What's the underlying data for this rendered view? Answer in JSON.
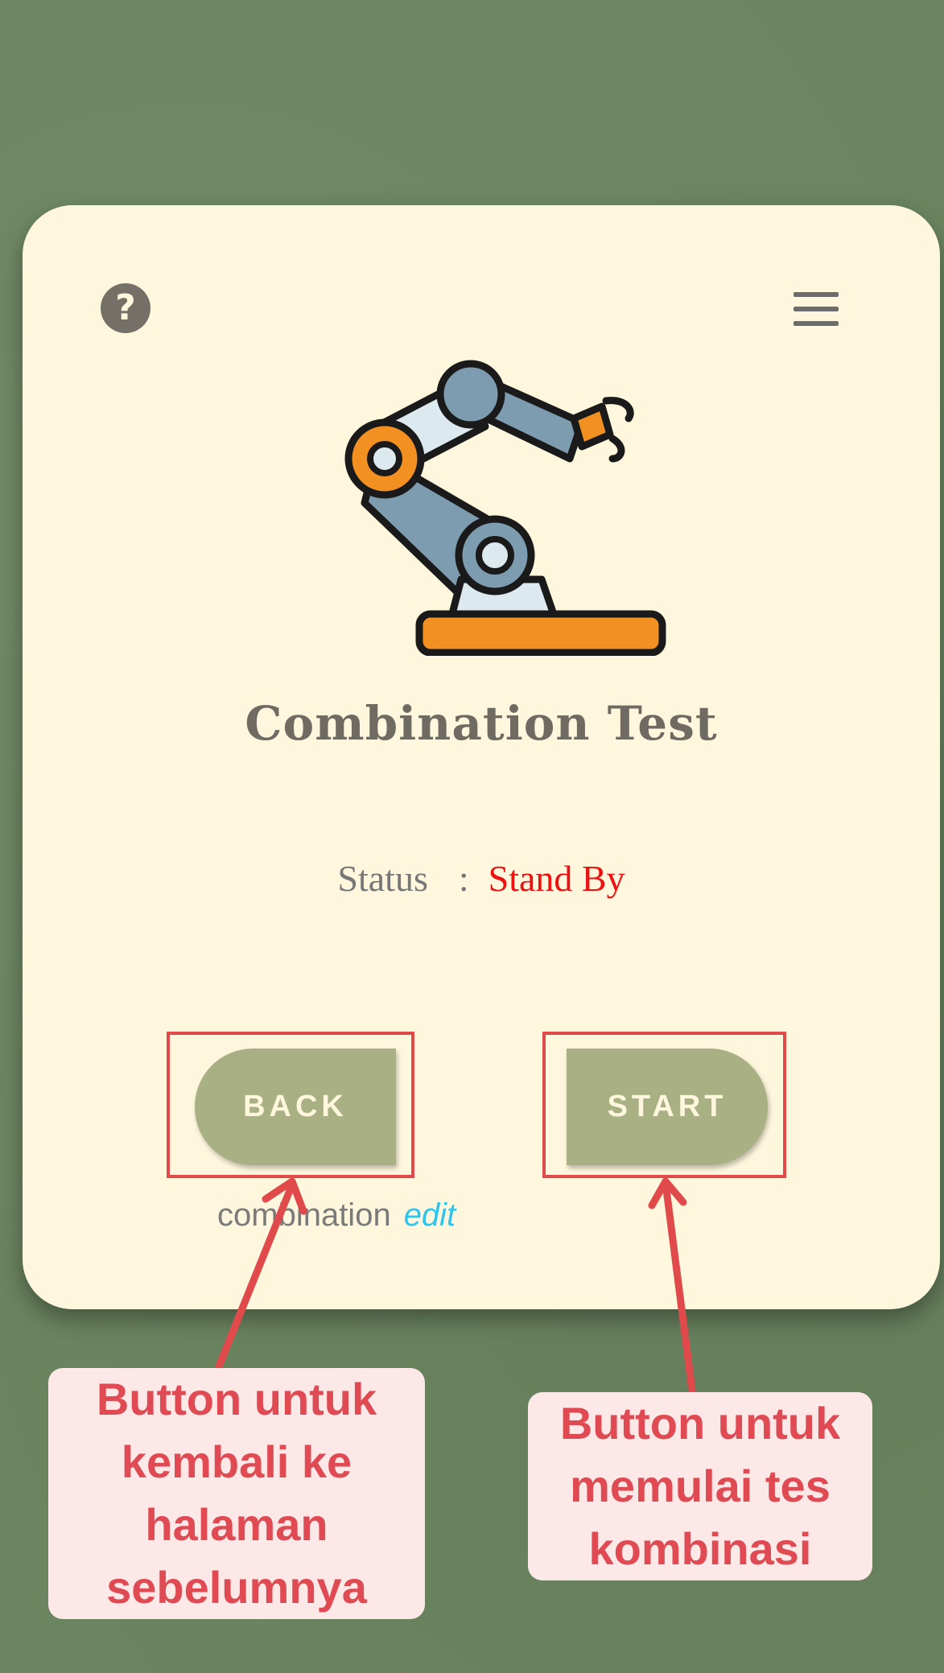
{
  "screen": {
    "title": "Combination Test",
    "status_label": "Status",
    "status_colon": ":",
    "status_value": "Stand By",
    "back_label": "BACK",
    "start_label": "START",
    "caption_text": "combination",
    "caption_link": "edit",
    "icons": {
      "help": "question-mark-circle-icon",
      "menu": "hamburger-menu-icon",
      "hero": "robotic-arm-icon"
    }
  },
  "annotations": {
    "back_note": "Button untuk kembali ke halaman sebelumnya",
    "start_note": "Button untuk memulai tes kombinasi"
  },
  "colors": {
    "background": "#6b8560",
    "card": "#fef7dd",
    "button": "#a9b084",
    "status_value": "#ee1111",
    "link": "#2ec4ee",
    "annotation": "#e04a4a",
    "annotation_bg": "#fde8e8"
  }
}
